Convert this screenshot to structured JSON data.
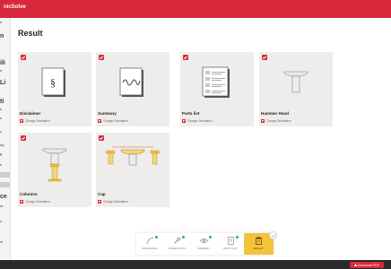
{
  "app": {
    "brand": "nicSolve",
    "accent": "#d9283b"
  },
  "sidebar": {
    "fragments": [
      "n",
      "ili",
      "n",
      "Li",
      "ti",
      "k",
      "s",
      "o",
      "ng",
      "g",
      "u",
      "ce",
      "ut",
      "o",
      "oi"
    ]
  },
  "page": {
    "title": "Result"
  },
  "cards": [
    {
      "name": "Disclaimer",
      "action": "Change Orientation",
      "icon": "section-document-icon"
    },
    {
      "name": "Summary",
      "action": "Change Orientation",
      "icon": "signature-document-icon"
    },
    {
      "name": "Parts list",
      "action": "Change Orientation",
      "icon": "parts-list-document-icon"
    },
    {
      "name": "Hammer Head",
      "action": "Change Orientation",
      "icon": "hammer-head-drawing"
    },
    {
      "name": "Columns",
      "action": "Change Orientation",
      "icon": "columns-drawing"
    },
    {
      "name": "Cap",
      "action": "Change Orientation",
      "icon": "cap-drawing"
    }
  ],
  "stepper": {
    "steps": [
      {
        "label": "DIMENSIONS",
        "icon": "arc-icon",
        "done": true
      },
      {
        "label": "CONNECTIONS",
        "icon": "wrench-icon",
        "done": true
      },
      {
        "label": "SUMMARY",
        "icon": "eye-icon",
        "done": true
      },
      {
        "label": "PARTS LIST",
        "icon": "list-icon",
        "done": true
      },
      {
        "label": "RESULT",
        "icon": "document-icon",
        "done": false,
        "active": true
      }
    ],
    "next_icon": "check-circle-icon"
  },
  "footer": {
    "download_label": "Download PDF"
  }
}
